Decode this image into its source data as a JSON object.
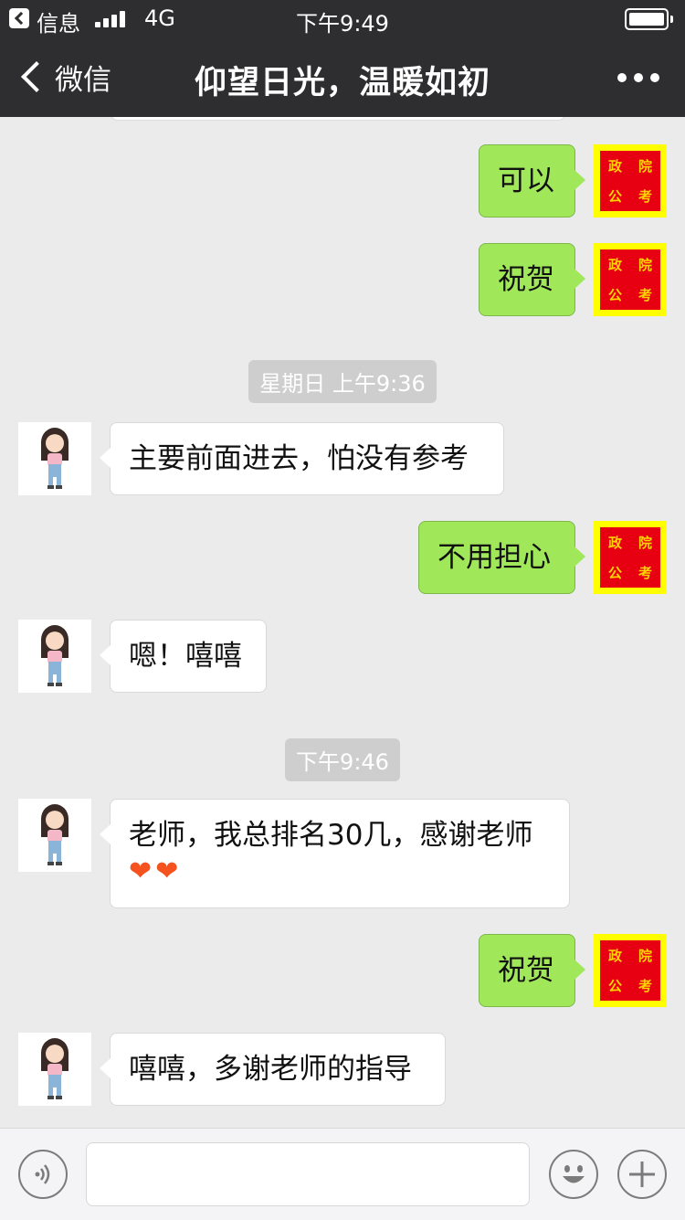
{
  "status_bar": {
    "carrier": "信息",
    "network": "4G",
    "time": "下午9:49"
  },
  "nav": {
    "back_label": "微信",
    "title": "仰望日光，温暖如初"
  },
  "avatar_text": {
    "line1a": "政",
    "line1b": "院",
    "line2a": "公",
    "line2b": "考"
  },
  "messages": [
    {
      "side": "out",
      "text": "可以"
    },
    {
      "side": "out",
      "text": "祝贺"
    },
    {
      "side": "time",
      "text": "星期日 上午9:36"
    },
    {
      "side": "in",
      "text": "主要前面进去，怕没有参考"
    },
    {
      "side": "out",
      "text": "不用担心"
    },
    {
      "side": "in",
      "text": "嗯！嘻嘻"
    },
    {
      "side": "time",
      "text": "下午9:46"
    },
    {
      "side": "in",
      "text": "老师，我总排名30几，感谢老师",
      "emoji": "❤❤"
    },
    {
      "side": "out",
      "text": "祝贺"
    },
    {
      "side": "in",
      "text": "嘻嘻，多谢老师的指导"
    }
  ],
  "input": {
    "placeholder": ""
  },
  "colors": {
    "bar": "#2e2e30",
    "bubble_out": "#a0e75a",
    "bubble_in": "#ffffff",
    "background": "#ebebeb"
  }
}
